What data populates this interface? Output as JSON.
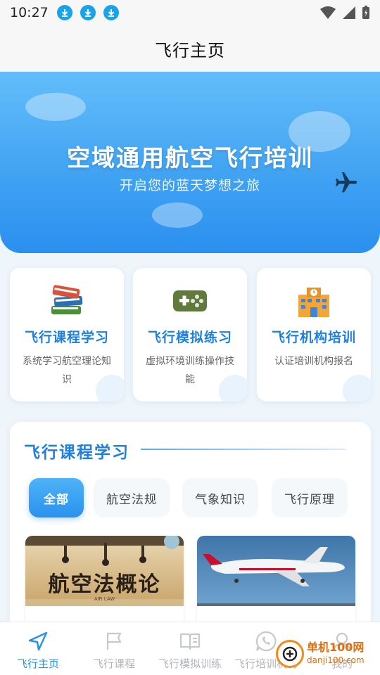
{
  "status_bar": {
    "time": "10:27",
    "notification_icons": [
      "download-icon",
      "download-icon",
      "download-icon"
    ],
    "right_icons": [
      "wifi-icon",
      "signal-icon",
      "battery-icon"
    ]
  },
  "header": {
    "title": "飞行主页"
  },
  "hero": {
    "title": "空域通用航空飞行培训",
    "subtitle": "开启您的蓝天梦想之旅",
    "icon": "airplane-icon"
  },
  "features": [
    {
      "title": "飞行课程学习",
      "desc": "系统学习航空理论知识",
      "icon": "books-icon"
    },
    {
      "title": "飞行模拟练习",
      "desc": "虚拟环境训练操作技能",
      "icon": "gamepad-icon"
    },
    {
      "title": "飞行机构培训",
      "desc": "认证培训机构报名",
      "icon": "school-building-icon"
    }
  ],
  "section": {
    "title": "飞行课程学习",
    "tabs": [
      {
        "label": "全部",
        "active": true
      },
      {
        "label": "航空法规",
        "active": false
      },
      {
        "label": "气象知识",
        "active": false
      },
      {
        "label": "飞行原理",
        "active": false
      }
    ],
    "courses": [
      {
        "thumb_text": "航空法概论",
        "thumb_sub": "AIR LAW"
      },
      {
        "thumb_text": "",
        "thumb_sub": ""
      }
    ]
  },
  "bottom_nav": [
    {
      "label": "飞行主页",
      "icon": "navigation-arrow-icon",
      "active": true
    },
    {
      "label": "飞行课程",
      "icon": "flag-icon",
      "active": false
    },
    {
      "label": "飞行模拟训练",
      "icon": "book-icon",
      "active": false
    },
    {
      "label": "飞行培训机构",
      "icon": "whatsapp-icon",
      "active": false
    },
    {
      "label": "我的",
      "icon": "user-icon",
      "active": false
    }
  ],
  "watermark": {
    "line1": "单机100网",
    "line2": "danji100.com"
  },
  "colors": {
    "accent": "#2a91ee",
    "hero_start": "#63bdfa",
    "hero_end": "#2b8ff0",
    "title_blue": "#1f7fde",
    "nav_inactive": "#b0b4ba"
  }
}
